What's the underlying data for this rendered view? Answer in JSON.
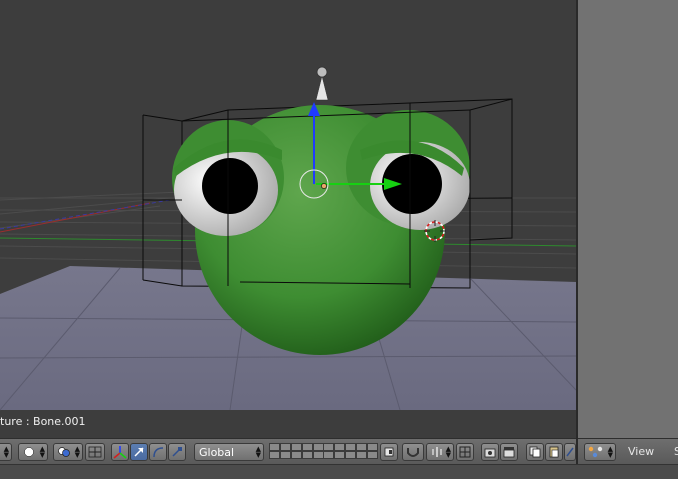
{
  "viewport": {
    "object_label": "ture : Bone.001"
  },
  "header": {
    "orientation_value": "Global",
    "view_menu_label": "View",
    "select_menu_label": "S"
  },
  "colors": {
    "background": "#3d3d3d",
    "floor": "#6f6f86",
    "model_green": "#3e8d32",
    "active_button": "#5c7eb2",
    "axis_blue": "#1f3bff",
    "axis_green": "#16d112",
    "axis_red": "#d22020"
  },
  "icons": {
    "editor_type": "dot-icon",
    "pivot": "pivot-icon",
    "manipulator_toggle": "axes-icon",
    "translate": "arrow-icon",
    "rotate": "rotate-icon",
    "scale": "scale-icon",
    "proportional": "magnet-icon",
    "snap": "snap-icon",
    "render": "camera-icon",
    "copy": "copy-icon",
    "paste": "paste-icon",
    "view_editor": "bone-icon"
  }
}
